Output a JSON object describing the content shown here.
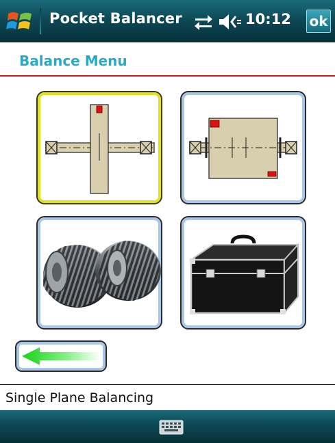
{
  "title_bar": {
    "app_title": "Pocket Balancer",
    "clock": "10:12",
    "ok_label": "ok",
    "icons": [
      "windows-start-icon",
      "connectivity-icon",
      "volume-icon"
    ]
  },
  "menu": {
    "header": "Balance Menu",
    "tiles": [
      {
        "name": "single-plane-balancing",
        "icon": "single-plane-rotor-icon",
        "selected": true
      },
      {
        "name": "two-plane-balancing",
        "icon": "two-plane-rotor-icon",
        "selected": false
      },
      {
        "name": "gears",
        "icon": "gears-icon",
        "selected": false
      },
      {
        "name": "toolbox",
        "icon": "toolcase-icon",
        "selected": false
      }
    ],
    "back_icon": "back-arrow-icon"
  },
  "status": {
    "text": "Single Plane Balancing"
  },
  "bottom_bar": {
    "icon": "keyboard-icon"
  },
  "colors": {
    "bar_gradient_top": "#1b6b7a",
    "bar_gradient_bottom": "#062f38",
    "header_text": "#2aa9c4",
    "header_rule": "#d02020",
    "selected_border": "#e3e220",
    "tile_border": "#a9c6e8",
    "arrow": "#22dd22"
  }
}
